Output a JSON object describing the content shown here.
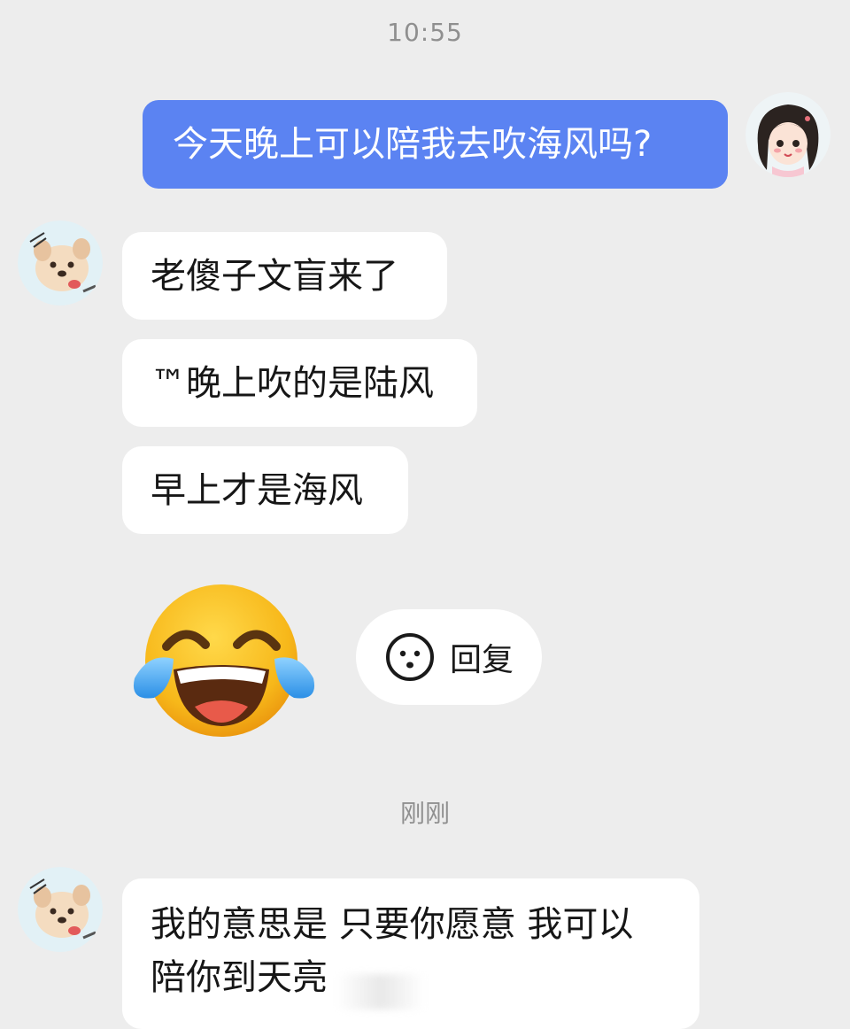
{
  "chat": {
    "timestamp_top": "10:55",
    "timestamp_recent": "刚刚",
    "messages": [
      {
        "sender": "self",
        "text": "今天晚上可以陪我去吹海风吗?"
      },
      {
        "sender": "other",
        "text": "老傻子文盲来了"
      },
      {
        "sender": "other",
        "text": "™晚上吹的是陆风"
      },
      {
        "sender": "other",
        "text": "早上才是海风"
      },
      {
        "sender": "other",
        "type": "sticker",
        "icon": "laughing-tears-emoji-icon"
      },
      {
        "sender": "other",
        "text_line1": "我的意思是 只要你愿意 我可以",
        "text_line2": "陪你到天亮"
      }
    ],
    "reply_chip": {
      "label": "回复",
      "icon": "smiley-face-icon"
    },
    "colors": {
      "background": "#ededed",
      "outgoing_bubble": "#5b83f2",
      "incoming_bubble": "#ffffff",
      "timestamp": "#8f8f8f"
    }
  }
}
